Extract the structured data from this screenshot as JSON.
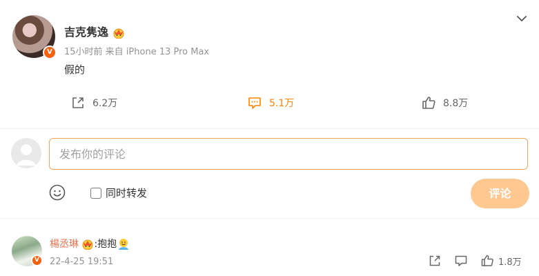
{
  "post": {
    "username": "吉克隽逸",
    "meta": "15小时前  来自 iPhone 13 Pro Max",
    "content": "假的",
    "verified_badge": "V",
    "accent_color": "#ff8200"
  },
  "actions": {
    "repost_count": "6.2万",
    "comment_count": "5.1万",
    "like_count": "8.8万"
  },
  "composer": {
    "placeholder": "发布你的评论",
    "repost_label": "同时转发",
    "submit_label": "评论"
  },
  "comment": {
    "username": "楊丞琳",
    "text": ":抱抱",
    "time": "22-4-25 19:51",
    "like_count": "1.8万",
    "verified_badge": "V"
  },
  "icons": [
    "chevron-down-icon",
    "repost-icon",
    "comment-icon",
    "like-icon",
    "emoji-icon",
    "crown-badge-icon",
    "hug-emoji-icon"
  ]
}
